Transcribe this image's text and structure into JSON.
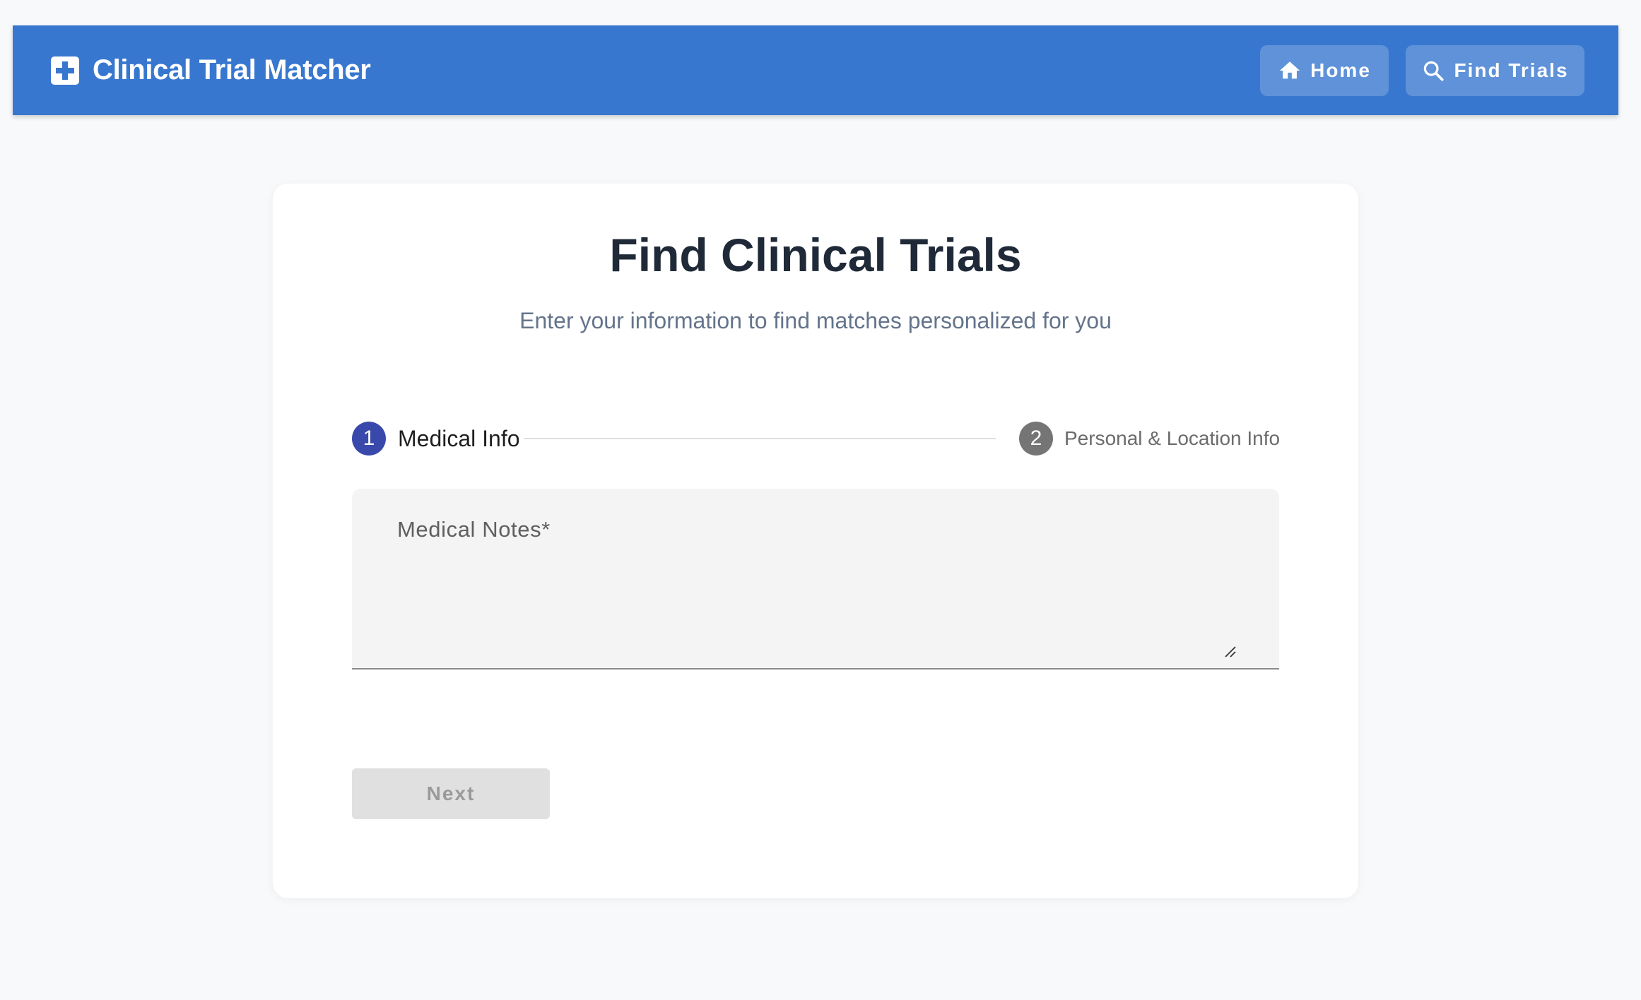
{
  "header": {
    "app_title": "Clinical Trial Matcher",
    "brand_icon": "medical-cross-icon",
    "nav": [
      {
        "label": "Home",
        "icon": "home-icon"
      },
      {
        "label": "Find Trials",
        "icon": "search-icon"
      }
    ]
  },
  "main": {
    "title": "Find Clinical Trials",
    "subtitle": "Enter your information to find matches personalized for you",
    "steps": [
      {
        "number": "1",
        "label": "Medical Info",
        "status": "active"
      },
      {
        "number": "2",
        "label": "Personal & Location Info",
        "status": "inactive"
      }
    ],
    "medical_notes": {
      "label": "Medical Notes*",
      "value": ""
    },
    "next_label": "Next"
  },
  "colors": {
    "app_bar": "#3877cf",
    "step_active": "#3949ab",
    "step_inactive": "#757575",
    "title_text": "#1f2937",
    "subtitle_text": "#64748b"
  }
}
